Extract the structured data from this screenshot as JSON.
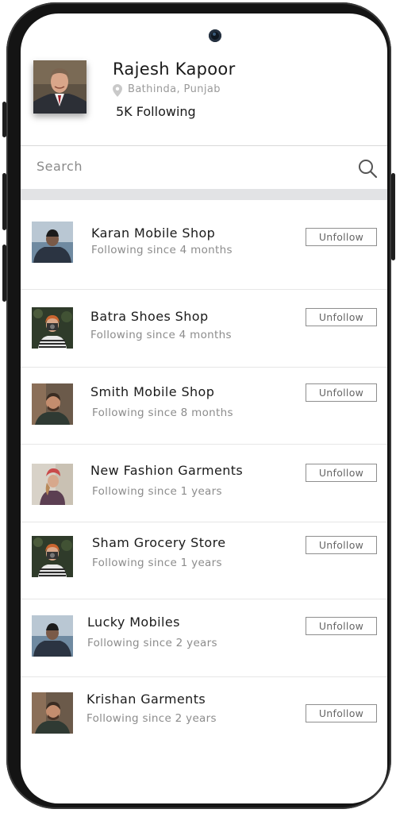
{
  "profile": {
    "name": "Rajesh Kapoor",
    "location": "Bathinda, Punjab",
    "following": "5K Following"
  },
  "search": {
    "placeholder": "Search"
  },
  "list": [
    {
      "title": "Karan Mobile Shop",
      "subtitle": "Following since 4 months",
      "button": "Unfollow"
    },
    {
      "title": "Batra Shoes Shop",
      "subtitle": "Following since 4 months",
      "button": "Unfollow"
    },
    {
      "title": "Smith Mobile Shop",
      "subtitle": "Following since 8 months",
      "button": "Unfollow"
    },
    {
      "title": "New Fashion Garments",
      "subtitle": "Following since 1 years",
      "button": "Unfollow"
    },
    {
      "title": "Sham Grocery Store",
      "subtitle": "Following since 1 years",
      "button": "Unfollow"
    },
    {
      "title": "Lucky Mobiles",
      "subtitle": "Following since 2 years",
      "button": "Unfollow"
    },
    {
      "title": "Krishan Garments",
      "subtitle": "Following since 2 years",
      "button": "Unfollow"
    }
  ]
}
